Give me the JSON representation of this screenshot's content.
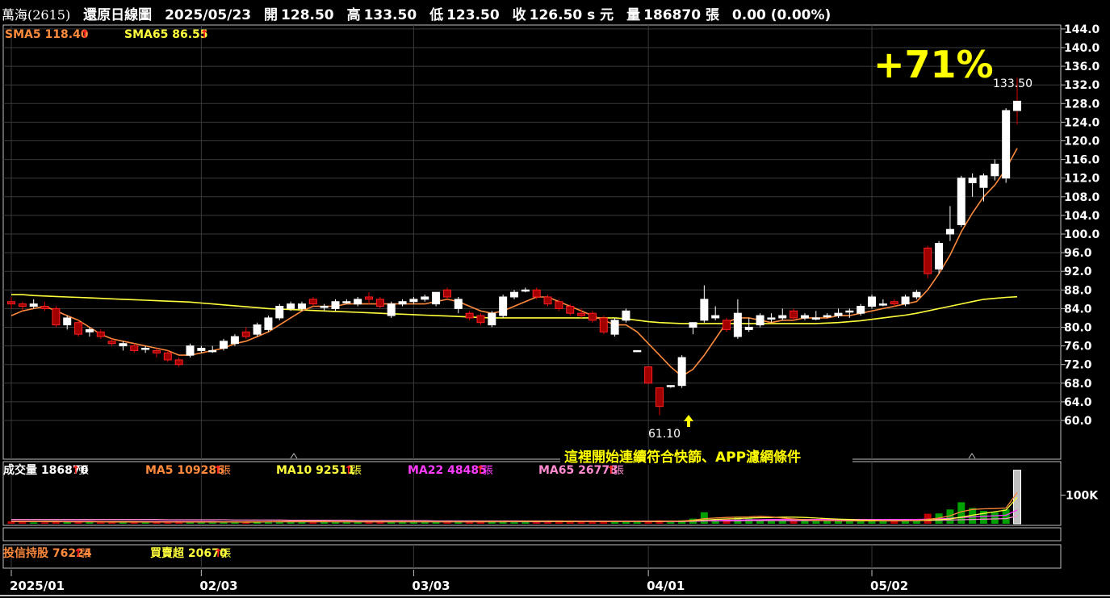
{
  "header": {
    "stock": "萬海(2615)",
    "chart_type_label": "還原日線圖",
    "date": "2025/05/23",
    "open_label": "開",
    "open": "128.50",
    "high_label": "高",
    "high": "133.50",
    "low_label": "低",
    "low": "123.50",
    "close_label": "收",
    "close": "126.50 s 元",
    "volume_label": "量",
    "volume": "186870 張",
    "change": "0.00 (0.00%)"
  },
  "price_legend": [
    {
      "label": "SMA5 118.40",
      "arrow": "↑",
      "color": "#ff8a3c"
    },
    {
      "label": "SMA65 86.55",
      "arrow": "↑",
      "color": "#ffff3c"
    }
  ],
  "annotations": {
    "gain": "+71%",
    "high_label": "133.50",
    "low_label": "61.10",
    "note": "這裡開始連續符合快篩、APP濾網條件"
  },
  "volume_legend": [
    {
      "label": "成交量 186870",
      "arrow": "↑",
      "unit": "張",
      "color": "#ffffff"
    },
    {
      "label": "MA5 109286",
      "arrow": "↑",
      "unit": "張",
      "color": "#ff8a3c"
    },
    {
      "label": "MA10 92511",
      "arrow": "↑",
      "unit": "張",
      "color": "#ffff3c"
    },
    {
      "label": "MA22 48485",
      "arrow": "↑",
      "unit": "張",
      "color": "#ff3cff"
    },
    {
      "label": "MA65 26778",
      "arrow": "↑",
      "unit": "張",
      "color": "#ff8ad0"
    }
  ],
  "volume_axis_label": "100K",
  "inst_legend": [
    {
      "label": "投信持股 76224",
      "arrow": "↑",
      "unit": "張",
      "color": "#ff8a3c"
    },
    {
      "label": "買賣超 20670",
      "arrow": "↑",
      "unit": "張",
      "color": "#ffff3c"
    }
  ],
  "chart_data": {
    "type": "candlestick",
    "price_axis_ticks": [
      60,
      64,
      68,
      72,
      76,
      80,
      84,
      88,
      92,
      96,
      100,
      104,
      108,
      112,
      116,
      120,
      124,
      128,
      132,
      136,
      140,
      144
    ],
    "date_ticks": [
      {
        "label": "2025/01",
        "index": 0
      },
      {
        "label": "02/03",
        "index": 17
      },
      {
        "label": "03/03",
        "index": 36
      },
      {
        "label": "04/01",
        "index": 57
      },
      {
        "label": "05/02",
        "index": 77
      }
    ],
    "candles": [
      [
        85.5,
        86.5,
        84.0,
        85.0
      ],
      [
        85.0,
        85.5,
        83.5,
        84.5
      ],
      [
        84.5,
        86.0,
        84.0,
        85.0
      ],
      [
        84.5,
        85.5,
        83.5,
        84.0
      ],
      [
        84.0,
        84.5,
        80.0,
        80.5
      ],
      [
        80.5,
        82.5,
        79.5,
        82.0
      ],
      [
        81.0,
        81.5,
        78.0,
        78.5
      ],
      [
        79.0,
        80.0,
        78.0,
        79.5
      ],
      [
        79.0,
        79.5,
        77.5,
        78.0
      ],
      [
        77.0,
        77.5,
        76.0,
        76.5
      ],
      [
        76.0,
        77.0,
        75.0,
        76.5
      ],
      [
        76.0,
        76.5,
        74.5,
        75.0
      ],
      [
        75.5,
        76.0,
        74.5,
        75.5
      ],
      [
        75.0,
        75.5,
        73.5,
        74.5
      ],
      [
        74.5,
        75.0,
        72.5,
        73.0
      ],
      [
        73.0,
        73.5,
        71.5,
        72.0
      ],
      [
        74.0,
        76.5,
        73.5,
        76.0
      ],
      [
        75.0,
        76.0,
        74.5,
        75.5
      ],
      [
        75.0,
        76.0,
        74.5,
        75.0
      ],
      [
        75.5,
        77.5,
        75.0,
        77.0
      ],
      [
        76.5,
        78.5,
        76.0,
        78.0
      ],
      [
        79.0,
        80.0,
        77.5,
        78.0
      ],
      [
        78.5,
        81.0,
        78.0,
        80.5
      ],
      [
        79.5,
        82.5,
        79.0,
        82.0
      ],
      [
        82.0,
        85.0,
        81.5,
        84.5
      ],
      [
        84.0,
        85.5,
        83.5,
        85.0
      ],
      [
        84.0,
        85.5,
        83.5,
        85.0
      ],
      [
        86.0,
        86.5,
        84.5,
        85.0
      ],
      [
        84.5,
        85.0,
        83.5,
        84.5
      ],
      [
        84.0,
        86.0,
        83.5,
        85.5
      ],
      [
        85.5,
        86.0,
        85.0,
        85.5
      ],
      [
        85.0,
        86.5,
        84.5,
        86.0
      ],
      [
        86.5,
        87.5,
        85.0,
        86.0
      ],
      [
        86.0,
        86.5,
        84.0,
        84.5
      ],
      [
        82.5,
        85.5,
        82.0,
        85.0
      ],
      [
        85.0,
        86.0,
        84.5,
        85.5
      ],
      [
        85.5,
        86.5,
        85.0,
        86.0
      ],
      [
        86.0,
        87.0,
        85.5,
        86.5
      ],
      [
        85.0,
        87.5,
        84.5,
        87.5
      ],
      [
        88.0,
        88.5,
        86.0,
        86.5
      ],
      [
        84.0,
        86.5,
        83.0,
        86.0
      ],
      [
        83.0,
        83.5,
        81.5,
        82.0
      ],
      [
        82.5,
        83.0,
        80.5,
        81.0
      ],
      [
        80.5,
        83.5,
        80.0,
        83.0
      ],
      [
        82.5,
        87.0,
        82.0,
        86.5
      ],
      [
        86.5,
        88.0,
        86.0,
        87.5
      ],
      [
        88.0,
        88.5,
        87.5,
        88.0
      ],
      [
        88.0,
        88.5,
        86.0,
        86.5
      ],
      [
        86.5,
        87.0,
        84.5,
        85.0
      ],
      [
        85.5,
        86.0,
        83.5,
        84.0
      ],
      [
        84.5,
        85.0,
        82.5,
        83.0
      ],
      [
        83.0,
        84.0,
        82.0,
        82.5
      ],
      [
        83.0,
        83.5,
        81.0,
        81.5
      ],
      [
        82.0,
        82.5,
        78.5,
        79.0
      ],
      [
        78.5,
        82.0,
        78.0,
        81.5
      ],
      [
        81.5,
        84.0,
        81.0,
        83.5
      ],
      [
        75.0,
        75.0,
        75.0,
        75.0
      ],
      [
        71.5,
        71.5,
        68.0,
        68.0
      ],
      [
        67.0,
        67.0,
        61.1,
        63.0
      ],
      [
        67.5,
        67.5,
        67.0,
        67.5
      ],
      [
        67.5,
        74.0,
        67.0,
        73.5
      ],
      [
        80.0,
        81.0,
        78.5,
        81.0
      ],
      [
        81.5,
        89.0,
        81.0,
        86.0
      ],
      [
        82.0,
        84.5,
        81.5,
        82.5
      ],
      [
        81.5,
        82.0,
        79.0,
        79.5
      ],
      [
        78.0,
        86.0,
        77.5,
        83.0
      ],
      [
        79.5,
        82.0,
        79.0,
        80.0
      ],
      [
        80.5,
        83.0,
        80.0,
        82.5
      ],
      [
        82.0,
        83.0,
        81.0,
        82.0
      ],
      [
        82.0,
        84.0,
        81.5,
        82.5
      ],
      [
        83.5,
        84.0,
        81.5,
        82.0
      ],
      [
        82.0,
        83.0,
        81.5,
        82.5
      ],
      [
        82.0,
        83.5,
        81.5,
        82.0
      ],
      [
        82.5,
        83.0,
        82.0,
        82.5
      ],
      [
        82.5,
        84.0,
        82.0,
        83.0
      ],
      [
        83.5,
        84.0,
        82.0,
        83.5
      ],
      [
        83.0,
        85.0,
        82.5,
        84.5
      ],
      [
        84.5,
        87.0,
        84.0,
        86.5
      ],
      [
        85.0,
        86.0,
        84.5,
        85.0
      ],
      [
        85.5,
        86.0,
        84.5,
        85.0
      ],
      [
        85.0,
        87.0,
        84.5,
        86.5
      ],
      [
        86.5,
        88.0,
        86.0,
        87.5
      ],
      [
        97.0,
        97.5,
        90.5,
        91.5
      ],
      [
        92.5,
        98.5,
        91.5,
        98.0
      ],
      [
        100.0,
        106.0,
        98.5,
        101.0
      ],
      [
        102.0,
        112.5,
        101.5,
        112.0
      ],
      [
        111.0,
        113.0,
        108.0,
        112.0
      ],
      [
        110.0,
        113.0,
        107.0,
        112.5
      ],
      [
        112.5,
        116.0,
        111.5,
        115.0
      ],
      [
        112.0,
        127.0,
        111.0,
        126.5
      ],
      [
        128.5,
        133.5,
        123.5,
        126.5
      ]
    ],
    "sma5": [
      82.5,
      83.5,
      84.0,
      84.5,
      83.5,
      82.5,
      81.5,
      80.0,
      78.5,
      77.5,
      77.0,
      76.5,
      76.0,
      75.5,
      75.0,
      74.0,
      74.0,
      74.5,
      75.0,
      75.5,
      76.5,
      77.0,
      78.0,
      79.0,
      80.5,
      82.0,
      83.5,
      84.5,
      84.5,
      84.5,
      85.0,
      85.0,
      85.0,
      85.0,
      85.0,
      85.0,
      85.0,
      85.0,
      85.5,
      86.0,
      85.5,
      84.5,
      83.5,
      83.0,
      83.5,
      84.5,
      85.5,
      86.5,
      86.5,
      85.5,
      84.5,
      83.5,
      82.5,
      81.5,
      80.5,
      80.5,
      79.0,
      76.5,
      74.0,
      71.5,
      69.5,
      71.0,
      74.0,
      77.5,
      81.0,
      82.0,
      82.0,
      81.5,
      81.0,
      81.5,
      81.5,
      82.0,
      82.0,
      82.0,
      82.5,
      82.5,
      83.0,
      83.5,
      84.0,
      84.5,
      85.0,
      85.5,
      88.0,
      91.5,
      95.5,
      100.5,
      104.5,
      108.0,
      110.5,
      114.0,
      118.4
    ],
    "sma65": [
      87.0,
      87.0,
      86.8,
      86.7,
      86.6,
      86.5,
      86.4,
      86.3,
      86.2,
      86.1,
      86.0,
      85.9,
      85.8,
      85.7,
      85.6,
      85.5,
      85.4,
      85.2,
      85.0,
      84.8,
      84.6,
      84.4,
      84.2,
      84.0,
      83.9,
      83.8,
      83.7,
      83.6,
      83.5,
      83.4,
      83.3,
      83.2,
      83.1,
      83.0,
      82.9,
      82.8,
      82.7,
      82.6,
      82.5,
      82.4,
      82.3,
      82.2,
      82.1,
      82.0,
      82.0,
      82.0,
      82.0,
      82.0,
      82.0,
      82.0,
      82.0,
      82.0,
      82.0,
      82.0,
      82.0,
      81.8,
      81.5,
      81.2,
      81.0,
      80.9,
      80.8,
      80.8,
      80.8,
      80.8,
      80.8,
      80.8,
      80.8,
      80.8,
      80.8,
      80.8,
      80.8,
      80.8,
      80.8,
      80.9,
      81.0,
      81.2,
      81.4,
      81.7,
      82.0,
      82.3,
      82.6,
      83.0,
      83.5,
      84.0,
      84.5,
      85.0,
      85.5,
      86.0,
      86.2,
      86.4,
      86.55
    ],
    "volume_k": [
      8,
      6,
      5,
      5,
      10,
      8,
      7,
      6,
      6,
      5,
      5,
      5,
      6,
      6,
      7,
      6,
      7,
      5,
      5,
      7,
      6,
      8,
      8,
      8,
      9,
      8,
      7,
      7,
      6,
      7,
      6,
      6,
      7,
      8,
      7,
      6,
      6,
      6,
      7,
      8,
      8,
      7,
      9,
      8,
      8,
      9,
      10,
      9,
      8,
      8,
      8,
      7,
      7,
      8,
      8,
      7,
      8,
      10,
      12,
      10,
      12,
      18,
      40,
      16,
      18,
      25,
      20,
      15,
      12,
      12,
      11,
      10,
      9,
      10,
      9,
      10,
      10,
      10,
      11,
      10,
      10,
      12,
      35,
      36,
      50,
      75,
      55,
      45,
      40,
      50,
      187
    ],
    "volume_ma5_k": [
      8,
      8,
      8,
      7,
      7,
      7,
      7,
      7,
      7,
      6,
      6,
      6,
      6,
      6,
      6,
      6,
      6,
      6,
      6,
      6,
      6,
      7,
      7,
      7,
      8,
      8,
      8,
      8,
      8,
      7,
      7,
      7,
      7,
      7,
      7,
      7,
      7,
      7,
      7,
      7,
      7,
      7,
      8,
      8,
      8,
      8,
      9,
      9,
      9,
      9,
      9,
      8,
      8,
      8,
      8,
      8,
      8,
      8,
      9,
      9,
      10,
      12,
      18,
      20,
      22,
      23,
      24,
      26,
      24,
      20,
      17,
      14,
      12,
      11,
      10,
      10,
      10,
      10,
      10,
      10,
      10,
      11,
      15,
      20,
      28,
      42,
      50,
      52,
      53,
      55,
      109
    ],
    "volume_ma10_k": [
      8,
      8,
      8,
      8,
      8,
      7,
      7,
      7,
      7,
      7,
      7,
      7,
      6,
      6,
      6,
      6,
      6,
      6,
      6,
      6,
      6,
      6,
      6,
      7,
      7,
      7,
      7,
      7,
      7,
      7,
      7,
      7,
      7,
      7,
      7,
      7,
      7,
      7,
      7,
      7,
      7,
      7,
      7,
      7,
      7,
      8,
      8,
      8,
      8,
      8,
      8,
      8,
      8,
      8,
      8,
      8,
      8,
      8,
      8,
      9,
      9,
      10,
      13,
      15,
      17,
      18,
      20,
      21,
      22,
      23,
      23,
      22,
      20,
      18,
      16,
      15,
      13,
      12,
      11,
      11,
      11,
      11,
      12,
      14,
      17,
      23,
      30,
      36,
      42,
      48,
      92
    ],
    "volume_ma22_k": [
      9,
      9,
      9,
      9,
      9,
      9,
      9,
      9,
      8,
      8,
      8,
      8,
      8,
      8,
      8,
      8,
      8,
      8,
      8,
      7,
      7,
      7,
      7,
      7,
      7,
      7,
      7,
      7,
      7,
      7,
      7,
      7,
      7,
      7,
      7,
      7,
      7,
      7,
      7,
      7,
      7,
      7,
      7,
      7,
      7,
      7,
      7,
      7,
      7,
      8,
      8,
      8,
      8,
      8,
      8,
      8,
      8,
      8,
      8,
      8,
      8,
      9,
      10,
      11,
      12,
      13,
      14,
      14,
      15,
      15,
      15,
      15,
      15,
      15,
      15,
      15,
      15,
      15,
      15,
      15,
      15,
      15,
      16,
      17,
      19,
      22,
      24,
      26,
      28,
      30,
      48
    ],
    "volume_ma65_k": [
      15,
      15,
      15,
      15,
      15,
      15,
      15,
      15,
      15,
      15,
      15,
      15,
      15,
      15,
      14,
      14,
      14,
      14,
      14,
      14,
      13,
      13,
      13,
      13,
      13,
      12,
      12,
      12,
      12,
      12,
      12,
      11,
      11,
      11,
      11,
      11,
      11,
      11,
      10,
      10,
      10,
      10,
      10,
      10,
      10,
      10,
      10,
      10,
      10,
      10,
      9,
      9,
      9,
      9,
      9,
      9,
      9,
      9,
      9,
      9,
      9,
      10,
      10,
      10,
      10,
      10,
      11,
      11,
      11,
      11,
      11,
      11,
      11,
      11,
      11,
      11,
      11,
      11,
      11,
      11,
      11,
      11,
      12,
      12,
      13,
      14,
      15,
      16,
      17,
      18,
      27
    ],
    "volume_axis": {
      "label_value_k": 100,
      "max_k": 200
    }
  }
}
